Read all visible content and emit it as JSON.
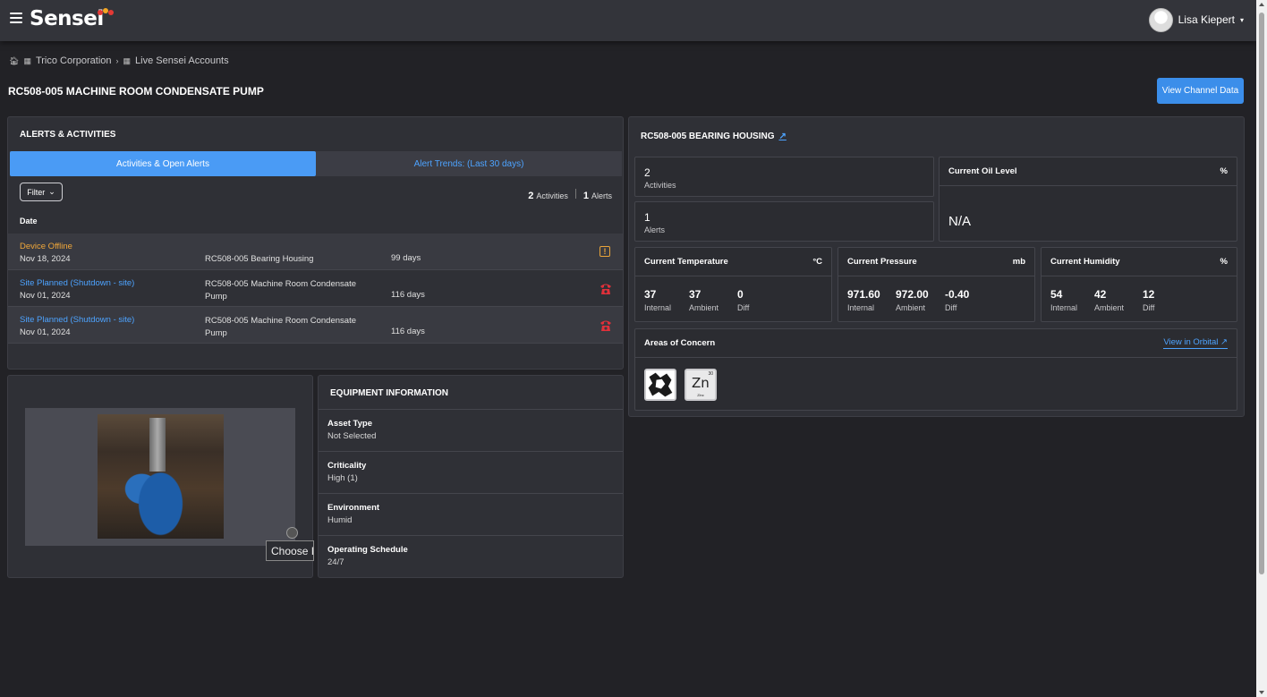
{
  "header": {
    "logo": "Sensei",
    "logo_dot_colors": [
      "#e53935",
      "#f5a623",
      "#e53935"
    ],
    "user_name": "Lisa Kiepert"
  },
  "breadcrumb": {
    "items": [
      "Trico Corporation",
      "Live Sensei Accounts"
    ]
  },
  "page": {
    "title": "RC508-005 MACHINE ROOM CONDENSATE PUMP",
    "view_channel_button": "View Channel Data"
  },
  "alerts": {
    "title": "ALERTS & ACTIVITIES",
    "tabs": [
      "Activities & Open Alerts",
      "Alert Trends: (Last 30 days)"
    ],
    "filter_label": "Filter",
    "activities_count": "2",
    "activities_label": "Activities",
    "alerts_count": "1",
    "alerts_label": "Alerts",
    "date_header": "Date",
    "rows": [
      {
        "title": "Device Offline",
        "title_color": "#f0a73a",
        "date": "Nov 18, 2024",
        "asset": "RC508-005 Bearing Housing",
        "days": "99 days",
        "icon": "alert-warning-icon"
      },
      {
        "title": "Site Planned (Shutdown - site)",
        "title_color": "#4da3ff",
        "date": "Nov 01, 2024",
        "asset": "RC508-005 Machine Room Condensate Pump",
        "days": "116 days",
        "icon": "phone-icon"
      },
      {
        "title": "Site Planned (Shutdown - site)",
        "title_color": "#4da3ff",
        "date": "Nov 01, 2024",
        "asset": "RC508-005 Machine Room Condensate Pump",
        "days": "116 days",
        "icon": "phone-icon"
      }
    ]
  },
  "photo": {
    "choose_label": "Choose I"
  },
  "equipment": {
    "title": "EQUIPMENT INFORMATION",
    "items": [
      {
        "label": "Asset Type",
        "value": "Not Selected"
      },
      {
        "label": "Criticality",
        "value": "High (1)"
      },
      {
        "label": "Environment",
        "value": "Humid"
      },
      {
        "label": "Operating Schedule",
        "value": "24/7"
      }
    ]
  },
  "bearing": {
    "title": "RC508-005 BEARING HOUSING",
    "activities_count": "2",
    "activities_label": "Activities",
    "alerts_count": "1",
    "alerts_label": "Alerts",
    "oil": {
      "title": "Current Oil Level",
      "unit": "%",
      "value": "N/A"
    },
    "temperature": {
      "title": "Current Temperature",
      "unit": "°C",
      "values": [
        {
          "v": "37",
          "l": "Internal"
        },
        {
          "v": "37",
          "l": "Ambient"
        },
        {
          "v": "0",
          "l": "Diff"
        }
      ]
    },
    "pressure": {
      "title": "Current Pressure",
      "unit": "mb",
      "values": [
        {
          "v": "971.60",
          "l": "Internal"
        },
        {
          "v": "972.00",
          "l": "Ambient"
        },
        {
          "v": "-0.40",
          "l": "Diff"
        }
      ]
    },
    "humidity": {
      "title": "Current Humidity",
      "unit": "%",
      "values": [
        {
          "v": "54",
          "l": "Internal"
        },
        {
          "v": "42",
          "l": "Ambient"
        },
        {
          "v": "12",
          "l": "Diff"
        }
      ]
    },
    "concern": {
      "title": "Areas of Concern",
      "link": "View in Orbital",
      "zinc_symbol": "Zn",
      "zinc_number": "30",
      "zinc_name": "Zinc"
    }
  }
}
